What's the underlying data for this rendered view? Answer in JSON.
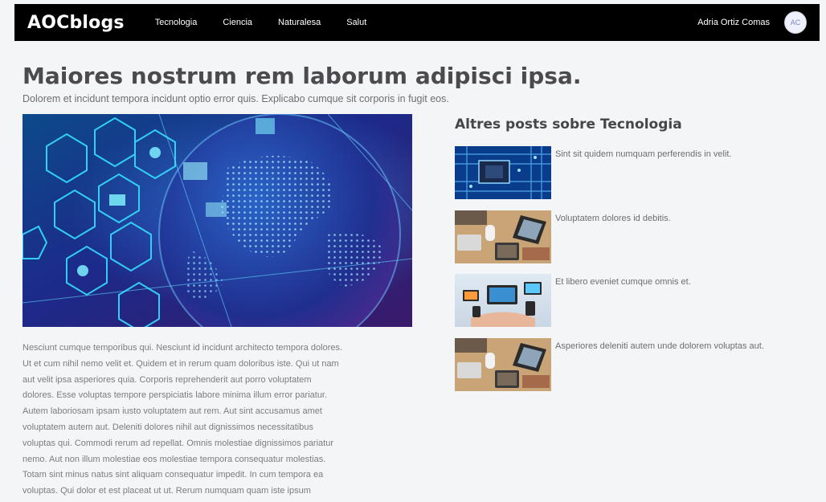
{
  "navbar": {
    "brand": "AOCblogs",
    "links": [
      "Tecnologia",
      "Ciencia",
      "Naturalesa",
      "Salut"
    ],
    "user_name": "Adria Ortiz Comas",
    "avatar_initials": "AC"
  },
  "article": {
    "title": "Maiores nostrum rem laborum adipisci ipsa.",
    "subtitle": "Dolorem et incidunt tempora incidunt optio error quis. Explicabo cumque sit corporis in fugit eos.",
    "body_lines": [
      "Nesciunt cumque temporibus qui. Nesciunt id incidunt architecto tempora dolores.",
      "Ut et cum nihil nemo velit et. Quidem et in rerum quam doloribus iste. Qui ut nam",
      "aut velit ipsa asperiores quia. Corporis reprehenderit aut porro voluptatem",
      "dolores. Esse voluptas tempore perspiciatis labore minima illum error pariatur.",
      "Autem laboriosam ipsam iusto voluptatem aut rem. Aut sint accusamus amet",
      "voluptatem autem aut. Deleniti dolores nihil aut dignissimos necessitatibus",
      "voluptas qui. Commodi rerum ad repellat. Omnis molestiae dignissimos pariatur",
      "nemo. Aut non illum molestiae eos molestiae tempora consequatur molestias.",
      "Totam sint minus natus sint aliquam consequatur impedit. In cum tempora ea",
      "voluptas. Qui dolor et est placeat ut ut. Rerum numquam quam iste ipsum"
    ]
  },
  "sidebar": {
    "title": "Altres posts sobre Tecnologia",
    "posts": [
      {
        "title": "Sint sit quidem numquam perferendis in velit.",
        "image": "circuit-chip"
      },
      {
        "title": "Voluptatem dolores id debitis.",
        "image": "desk-devices"
      },
      {
        "title": "Et libero eveniet cumque omnis et.",
        "image": "hand-devices"
      },
      {
        "title": "Asperiores deleniti autem unde dolorem voluptas aut.",
        "image": "desk-devices"
      }
    ]
  },
  "colors": {
    "navbar_bg": "#000000",
    "page_bg": "#f4f5f6",
    "title_text": "#4b4b4f",
    "body_text": "#7a7d81"
  }
}
